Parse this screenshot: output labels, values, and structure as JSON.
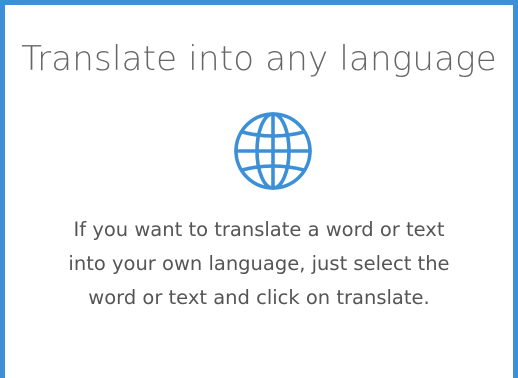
{
  "card": {
    "title": "Translate into any language",
    "icon": "globe-icon",
    "description_lines": [
      "If you want to translate a word or text",
      "into your own language, just select the",
      "word or text and click on translate."
    ]
  },
  "colors": {
    "accent": "#3d8fd6",
    "title_text": "#666666",
    "body_text": "#555555",
    "background": "#ffffff"
  }
}
